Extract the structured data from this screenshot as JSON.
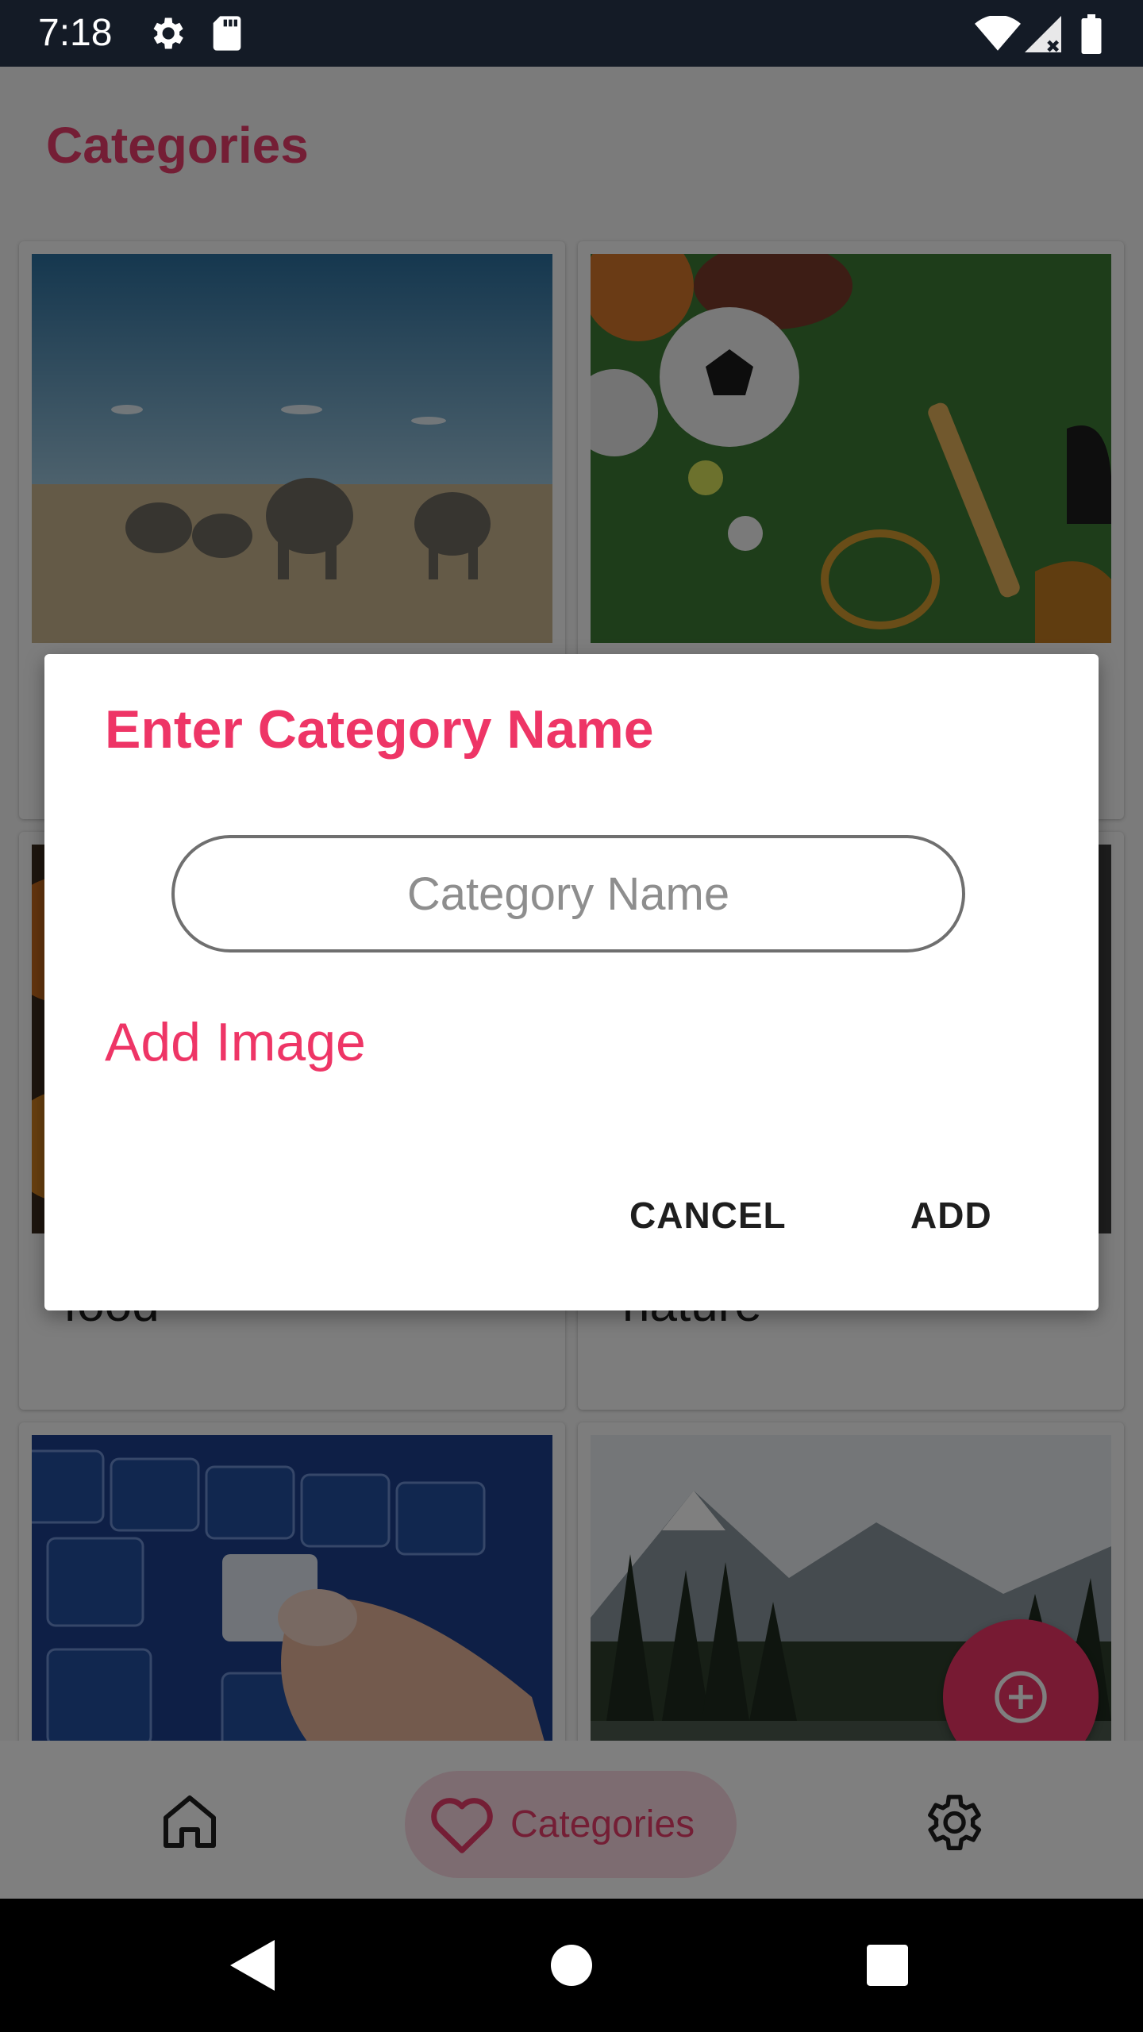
{
  "status_bar": {
    "time": "7:18"
  },
  "header": {
    "title": "Categories"
  },
  "categories": [
    {
      "label": "",
      "image": "savanna with elephants"
    },
    {
      "label": "",
      "image": "sports balls and racket on grass"
    },
    {
      "label": "food",
      "image": "food"
    },
    {
      "label": "nature",
      "image": "forest"
    },
    {
      "label": "",
      "image": "keyboard with finger"
    },
    {
      "label": "",
      "image": "mountain lake with trees"
    }
  ],
  "bottom_nav": {
    "items": [
      {
        "icon": "home-icon"
      },
      {
        "icon": "heart-icon",
        "label": "Categories",
        "selected": true
      },
      {
        "icon": "gear-icon"
      }
    ]
  },
  "fab": {
    "icon": "plus-circle-icon"
  },
  "dialog": {
    "title": "Enter Category Name",
    "input": {
      "placeholder": "Category Name",
      "value": ""
    },
    "add_image_label": "Add Image",
    "cancel_label": "CANCEL",
    "add_label": "ADD"
  },
  "colors": {
    "accent": "#ee3566",
    "title": "#e83d6b",
    "status_bar": "#141b26"
  }
}
